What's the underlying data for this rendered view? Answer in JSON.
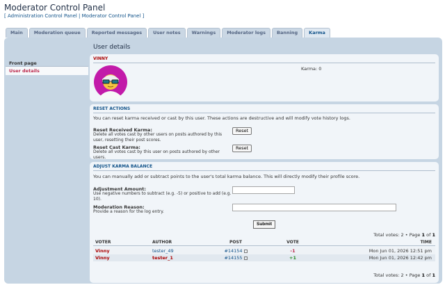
{
  "header": {
    "title": "Moderator Control Panel",
    "links": {
      "open": "[ ",
      "acp": "Administration Control Panel",
      "sep": " | ",
      "mcp": "Moderator Control Panel",
      "close": " ]"
    }
  },
  "tabs": [
    {
      "label": "Main"
    },
    {
      "label": "Moderation queue"
    },
    {
      "label": "Reported messages"
    },
    {
      "label": "User notes"
    },
    {
      "label": "Warnings"
    },
    {
      "label": "Moderator logs"
    },
    {
      "label": "Banning"
    },
    {
      "label": "Karma",
      "active": true
    }
  ],
  "sidebar": {
    "heading": "Front page",
    "items": [
      {
        "label": "User details"
      }
    ]
  },
  "main": {
    "title": "User details",
    "user": {
      "name": "VINNY",
      "karma_label": "Karma:",
      "karma_value": "0"
    },
    "reset": {
      "heading": "RESET ACTIONS",
      "desc": "You can reset karma received or cast by this user. These actions are destructive and will modify vote history logs.",
      "received_label": "Reset Received Karma:",
      "received_desc": "Delete all votes cast by other users on posts authored by this user, resetting their post scores.",
      "cast_label": "Reset Cast Karma:",
      "cast_desc": "Delete all votes cast by this user on posts authored by other users.",
      "button": "Reset"
    },
    "adjust": {
      "heading": "ADJUST KARMA BALANCE",
      "desc": "You can manually add or subtract points to the user's total karma balance. This will directly modify their profile score.",
      "amount_label": "Adjustment Amount:",
      "amount_desc": "Use negative numbers to subtract (e.g. -5) or positive to add (e.g. 10).",
      "reason_label": "Moderation Reason:",
      "reason_desc": "Provide a reason for the log entry.",
      "submit": "Submit"
    },
    "votes": {
      "total_label": "Total votes:",
      "total": "2",
      "page_text": "Page",
      "page": "1",
      "of": "of",
      "pages": "1",
      "bullet": "•",
      "columns": [
        "VOTER",
        "AUTHOR",
        "POST",
        "VOTE",
        "TIME"
      ],
      "rows": [
        {
          "voter": "Vinny",
          "author": "tester_49",
          "post": "#14154",
          "vote": "-1",
          "time": "Mon Jun 01, 2026 12:51 pm"
        },
        {
          "voter": "Vinny",
          "author": "tester_1",
          "post": "#14155",
          "vote": "+1",
          "time": "Mon Jun 01, 2026 12:42 pm"
        }
      ]
    }
  },
  "colors": {
    "accent": "#105289",
    "panel": "#c6d5e3",
    "danger": "#aa0000"
  }
}
